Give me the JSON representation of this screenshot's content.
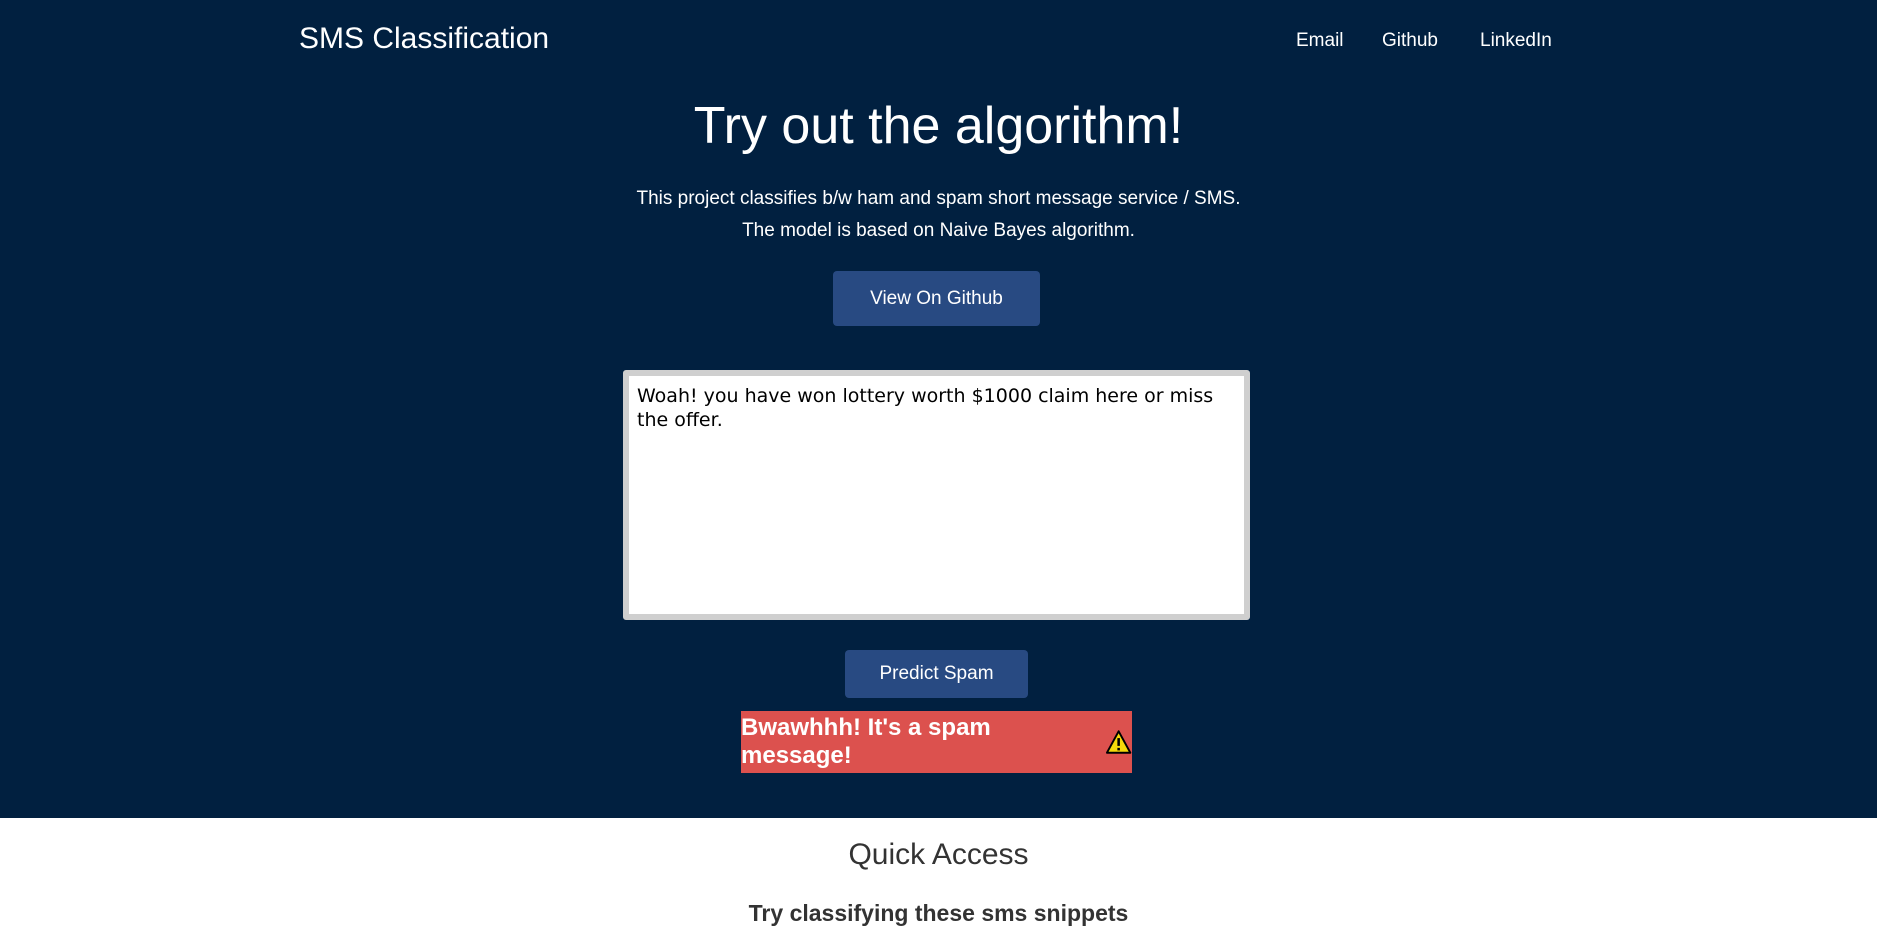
{
  "header": {
    "brand": "SMS Classification",
    "nav": {
      "email": "Email",
      "github": "Github",
      "linkedin": "LinkedIn"
    }
  },
  "hero": {
    "title": "Try out the algorithm!",
    "description_line1": "This project classifies b/w ham and spam short message service / SMS.",
    "description_line2": "The model is based on Naive Bayes algorithm.",
    "github_button": "View On Github"
  },
  "form": {
    "message_value": "Woah! you have won lottery worth $1000 claim here or miss the offer.",
    "predict_button": "Predict Spam"
  },
  "result": {
    "text": "Bwawhhh! It's a spam message!",
    "icon": "warning-icon",
    "color": "#dc514e"
  },
  "quick_access": {
    "title": "Quick Access",
    "subtitle": "Try classifying these sms snippets"
  },
  "colors": {
    "hero_bg": "#012040",
    "button": "#284a82"
  }
}
